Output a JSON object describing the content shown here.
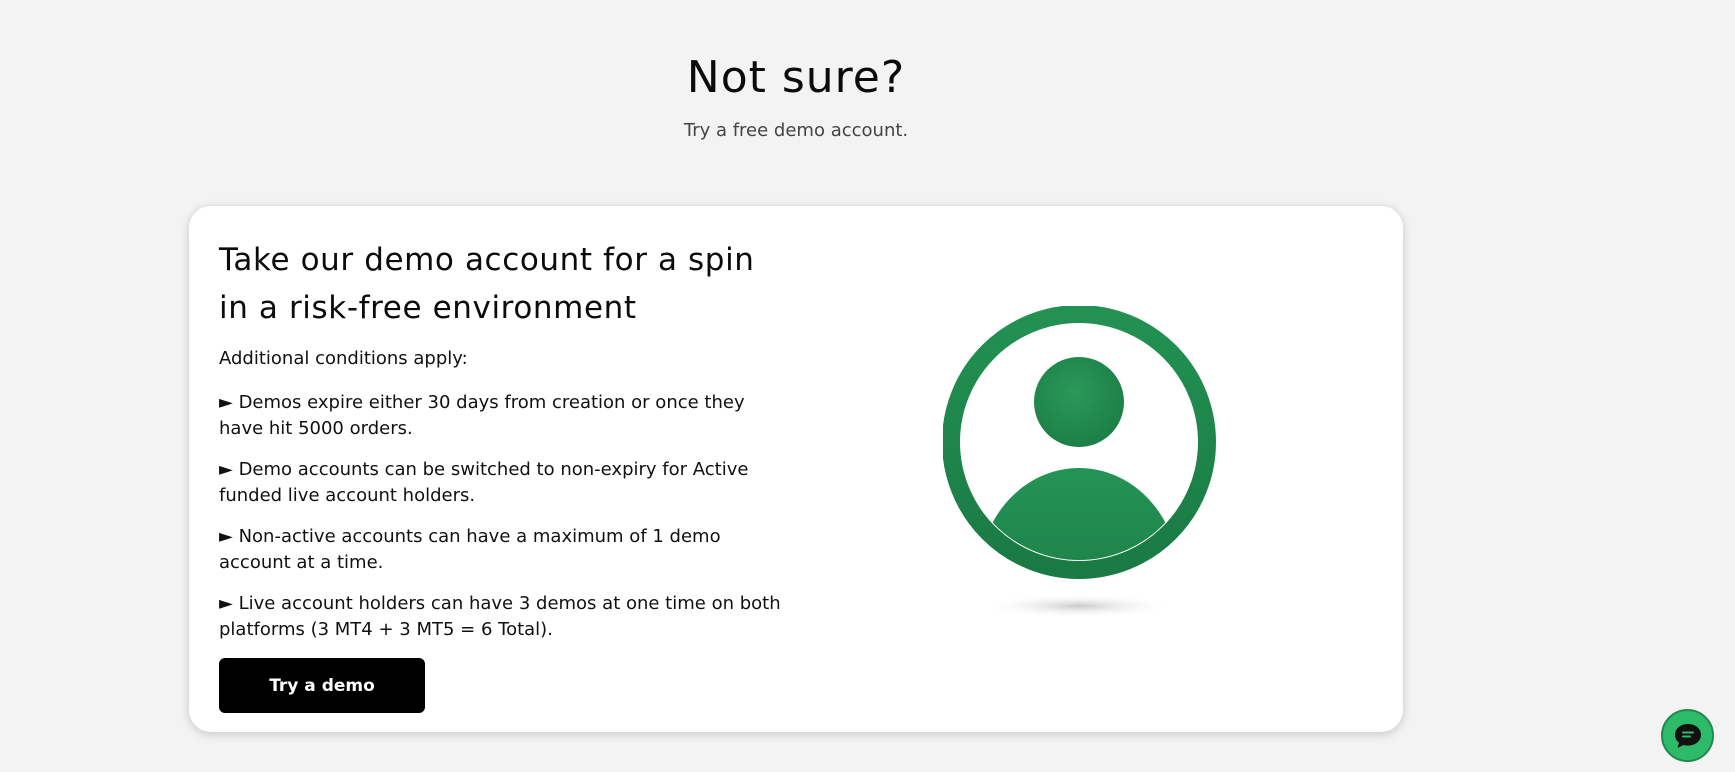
{
  "header": {
    "title": "Not sure?",
    "subtitle": "Try a free demo account."
  },
  "card": {
    "heading": "Take our demo account for a spin in a risk-free environment",
    "intro": "Additional conditions apply:",
    "conditions": [
      "► Demos expire either 30 days from creation or once they have hit 5000 orders.",
      "► Demo accounts can be switched to non-expiry for Active funded live account holders.",
      "► Non-active accounts can have a maximum of 1 demo account at a time.",
      "► Live account holders can have 3 demos at one time on both platforms (3 MT4 + 3 MT5 = 6 Total)."
    ],
    "button_label": "Try a demo",
    "illustration_icon": "user-avatar-icon"
  },
  "chat": {
    "icon": "chat-bubble-icon"
  },
  "colors": {
    "background": "#f3f3f3",
    "card": "#ffffff",
    "accent_green": "#1f8a4c",
    "button": "#000000",
    "chat_green": "#2dbb6a"
  }
}
